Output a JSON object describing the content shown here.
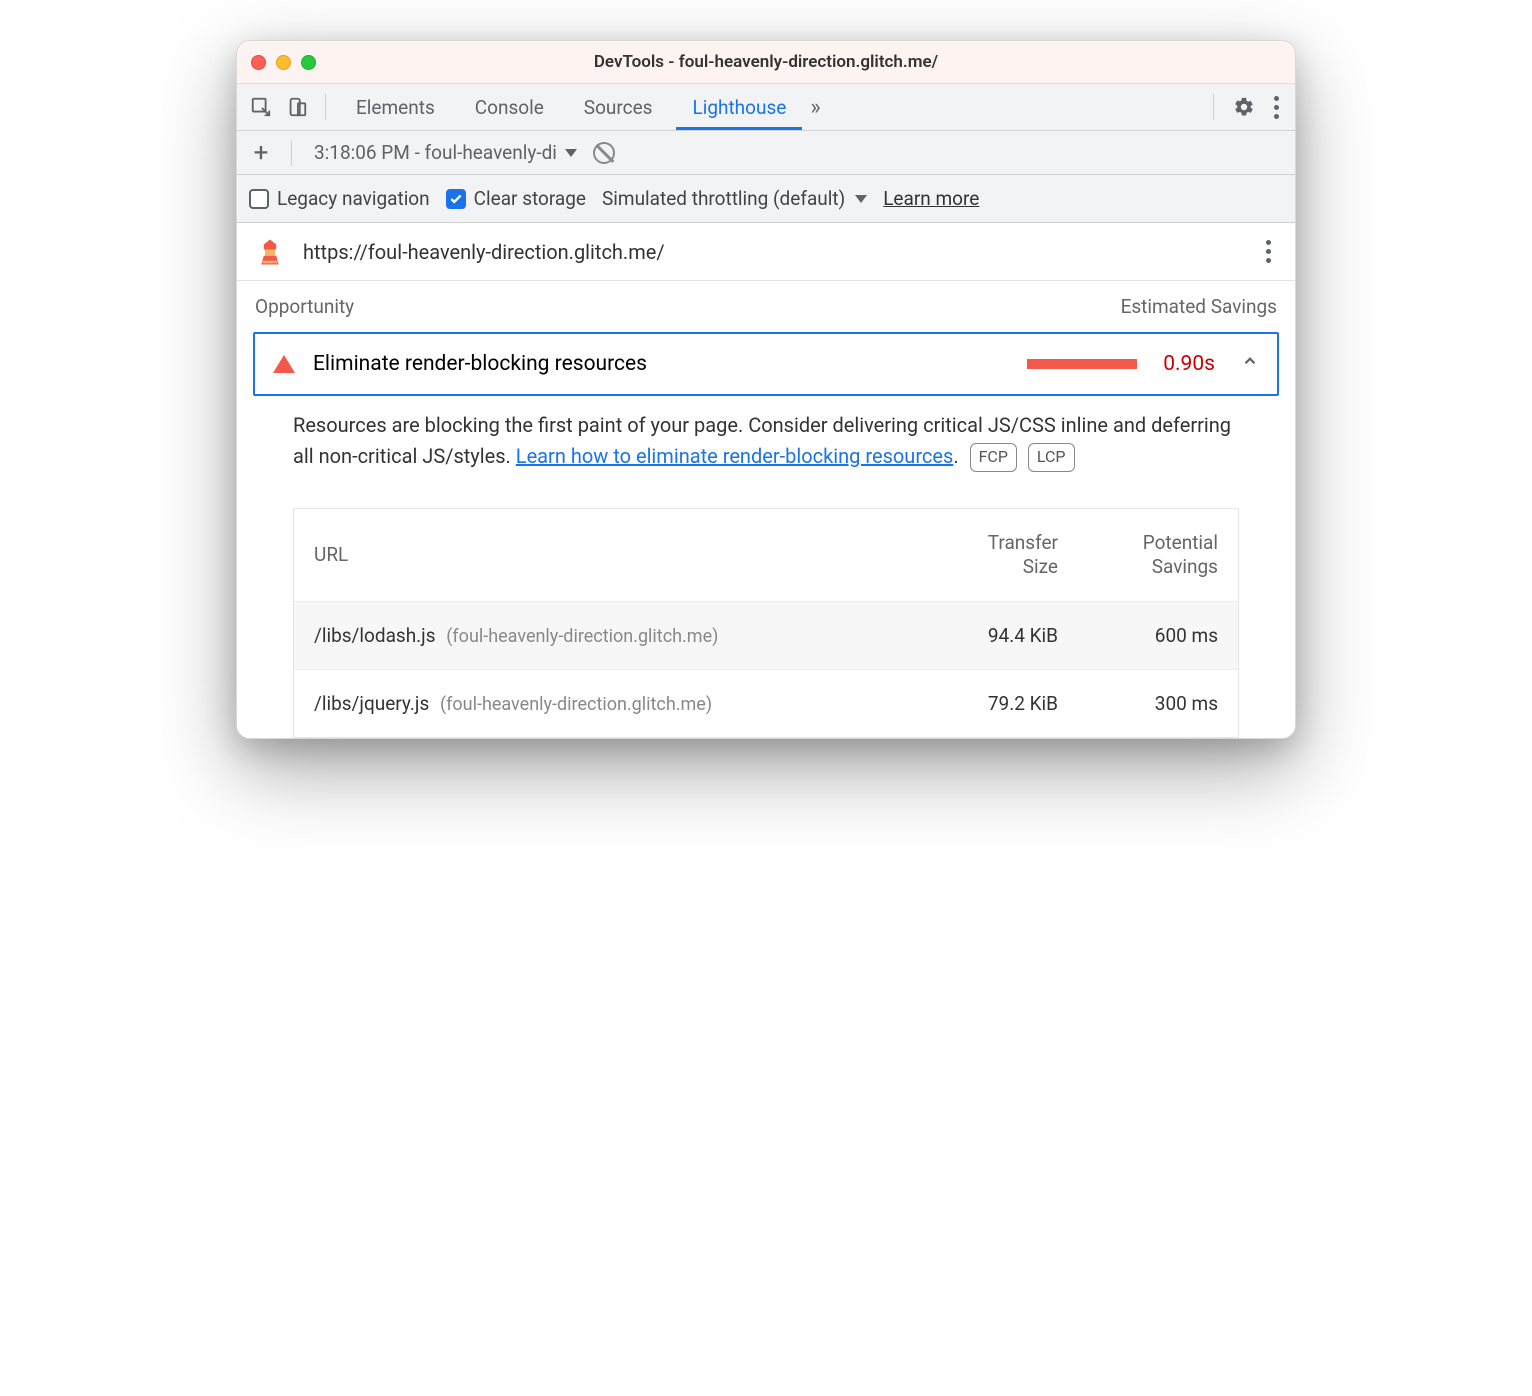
{
  "window": {
    "title": "DevTools - foul-heavenly-direction.glitch.me/"
  },
  "tabs": {
    "items": [
      "Elements",
      "Console",
      "Sources",
      "Lighthouse"
    ],
    "active": "Lighthouse"
  },
  "reportSelector": {
    "text": "3:18:06 PM - foul-heavenly-di"
  },
  "options": {
    "legacy_label": "Legacy navigation",
    "legacy_checked": false,
    "clear_label": "Clear storage",
    "clear_checked": true,
    "throttling_label": "Simulated throttling (default)",
    "learn_more": "Learn more"
  },
  "urlbar": {
    "url": "https://foul-heavenly-direction.glitch.me/"
  },
  "section": {
    "left": "Opportunity",
    "right": "Estimated Savings"
  },
  "opportunity": {
    "title": "Eliminate render-blocking resources",
    "savings": "0.90s"
  },
  "description": {
    "text_a": "Resources are blocking the first paint of your page. Consider delivering critical JS/CSS inline and deferring all non-critical JS/styles. ",
    "link": "Learn how to eliminate render-blocking resources",
    "text_b": ".",
    "badge1": "FCP",
    "badge2": "LCP"
  },
  "table": {
    "headers": {
      "url": "URL",
      "size": "Transfer\nSize",
      "savings": "Potential\nSavings"
    },
    "rows": [
      {
        "path": "/libs/lodash.js",
        "host": "(foul-heavenly-direction.glitch.me)",
        "size": "94.4 KiB",
        "savings": "600 ms"
      },
      {
        "path": "/libs/jquery.js",
        "host": "(foul-heavenly-direction.glitch.me)",
        "size": "79.2 KiB",
        "savings": "300 ms"
      }
    ]
  }
}
